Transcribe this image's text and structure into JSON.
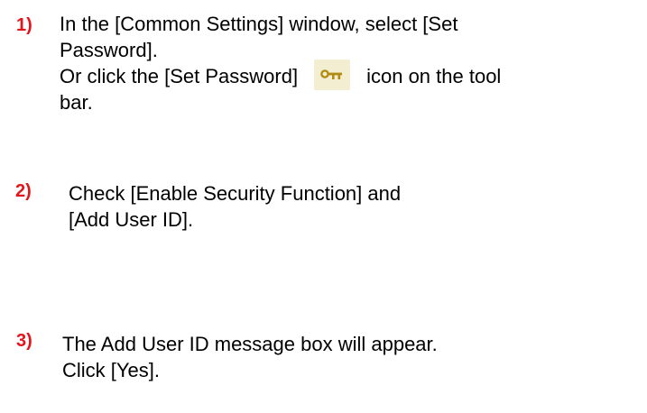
{
  "steps": [
    {
      "number": "1)",
      "lines": [
        "In the [Common Settings] window, select [Set",
        "Password]."
      ],
      "line3_before": "Or click the [Set Password]",
      "line3_after": "icon on the tool",
      "line4": "bar.",
      "icon": "key-icon"
    },
    {
      "number": "2)",
      "lines": [
        "Check [Enable Security Function] and",
        "[Add User ID]."
      ]
    },
    {
      "number": "3)",
      "lines": [
        "The Add User ID message box will appear.",
        "Click [Yes]."
      ]
    }
  ],
  "colors": {
    "step_number": "#e3141c",
    "text": "#000000",
    "icon_background": "#f3edd2",
    "icon_key": "#b08d12"
  }
}
